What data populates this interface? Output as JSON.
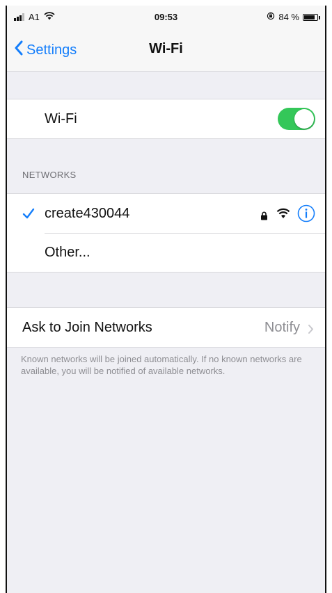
{
  "status_bar": {
    "carrier": "A1",
    "time": "09:53",
    "battery_percent": "84 %",
    "battery_level": 0.84
  },
  "nav": {
    "back_label": "Settings",
    "title": "Wi-Fi"
  },
  "wifi_toggle": {
    "label": "Wi-Fi",
    "enabled": true
  },
  "networks": {
    "header": "NETWORKS",
    "connected": {
      "name": "create430044",
      "secured": true
    },
    "other_label": "Other..."
  },
  "ask_to_join": {
    "label": "Ask to Join Networks",
    "value": "Notify",
    "footnote": "Known networks will be joined automatically. If no known networks are available, you will be notified of available networks."
  },
  "colors": {
    "accent": "#147efb",
    "toggle_on": "#34c759",
    "background": "#efeff4"
  }
}
